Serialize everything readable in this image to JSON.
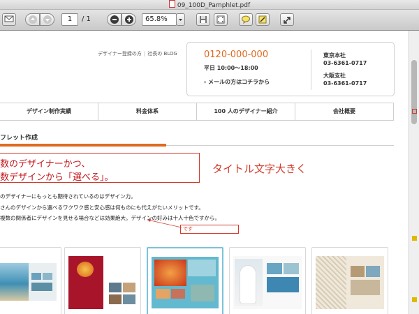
{
  "window": {
    "title": "09_100D_Pamphlet.pdf"
  },
  "toolbar": {
    "page_current": "1",
    "page_total": "/ 1",
    "zoom": "65.8%",
    "icons": [
      "mail-icon",
      "page-up-icon",
      "page-down-icon",
      "zoom-out-icon",
      "zoom-in-icon",
      "zoom-select-icon",
      "save-icon",
      "fit-page-icon",
      "comment-icon",
      "annotate-icon",
      "fullscreen-icon"
    ]
  },
  "site": {
    "top_links": [
      "デザイナー登録の方",
      "社長の BLOG"
    ],
    "contact": {
      "phone": "0120-000-000",
      "hours": "平日 10:00～18:00",
      "mail": "› メールの方はコチラから",
      "offices": [
        {
          "name": "東京本社",
          "tel": "03-6361-0717"
        },
        {
          "name": "大阪支社",
          "tel": "03-6361-0717"
        }
      ]
    },
    "nav": [
      "デザイン制作実績",
      "料金体系",
      "100 人のデザイナー紹介",
      "会社概要"
    ],
    "section_heading": "フレット作成",
    "headline_lines": [
      "数のデザイナーかつ、",
      "数デザインから「選べる」。"
    ],
    "body_lines": [
      "のデザイナーにもっとも期待されているのはデザイン力。",
      "さんのデザインから選べるワクワク感と安心感は何ものにも代えがたいメリットです。",
      "複数の関係者にデザインを見せる場合などは効果絶大。デザインの好みは十人十色ですから。"
    ]
  },
  "annotations": {
    "note_large": "タイトル文字大きく",
    "note_small": "です"
  },
  "colors": {
    "accent": "#e06a20",
    "annotation": "#d23b2b",
    "headline": "#c4161c"
  }
}
